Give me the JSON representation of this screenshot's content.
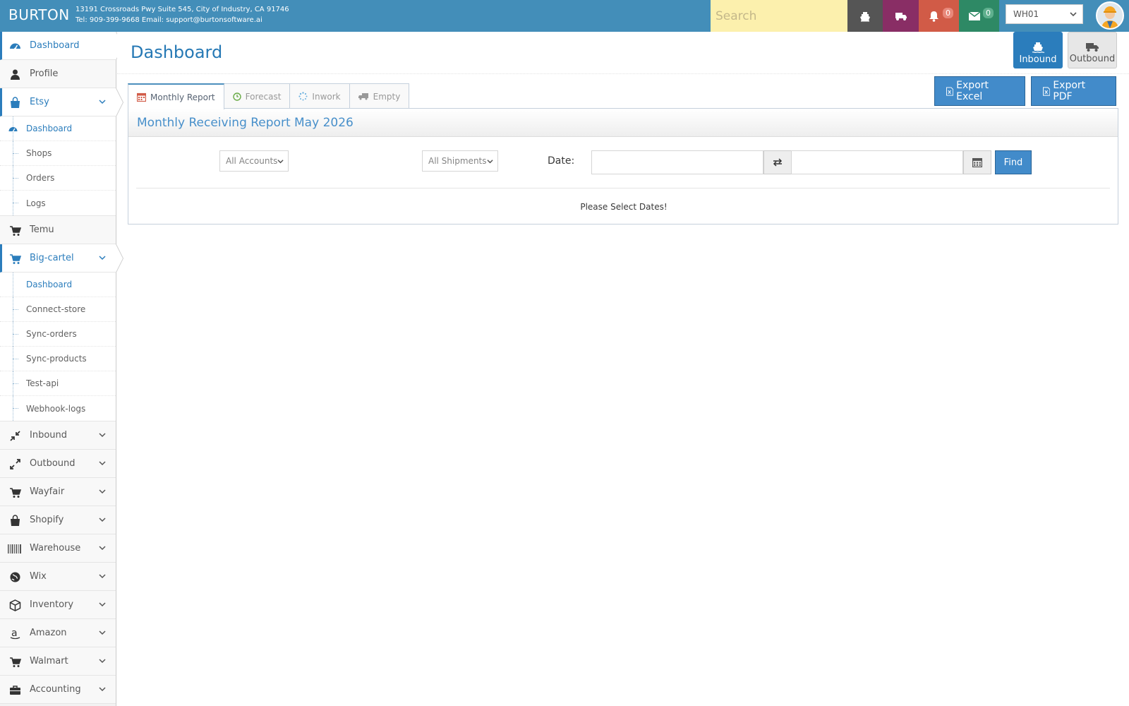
{
  "header": {
    "brand": "BURTON",
    "address_line1": "13191 Crossroads Pwy Suite 545, City of Industry, CA 91746",
    "address_line2": "Tel: 909-399-9668 Email: support@burtonsoftware.ai",
    "search_placeholder": "Search",
    "notifications_count": "0",
    "messages_count": "0",
    "warehouse_selected": "WH01",
    "colors": {
      "bar": "#438eb9",
      "search_bg": "#fcf0ad",
      "ship": "#555555",
      "truck": "#892e65",
      "bell": "#d15b47",
      "mail": "#2e8965"
    }
  },
  "sidebar": {
    "items": [
      {
        "label": "Dashboard",
        "icon": "tachometer-icon"
      },
      {
        "label": "Profile",
        "icon": "user-icon"
      },
      {
        "label": "Etsy",
        "icon": "shopping-bag-icon",
        "sub": [
          {
            "label": "Dashboard"
          },
          {
            "label": "Shops"
          },
          {
            "label": "Orders"
          },
          {
            "label": "Logs"
          }
        ]
      },
      {
        "label": "Temu",
        "icon": "cart-icon"
      },
      {
        "label": "Big-cartel",
        "icon": "cart-icon",
        "sub": [
          {
            "label": "Dashboard"
          },
          {
            "label": "Connect-store"
          },
          {
            "label": "Sync-orders"
          },
          {
            "label": "Sync-products"
          },
          {
            "label": "Test-api"
          },
          {
            "label": "Webhook-logs"
          }
        ]
      },
      {
        "label": "Inbound",
        "icon": "compress-icon"
      },
      {
        "label": "Outbound",
        "icon": "expand-icon"
      },
      {
        "label": "Wayfair",
        "icon": "cart-icon"
      },
      {
        "label": "Shopify",
        "icon": "shopping-bag-icon"
      },
      {
        "label": "Warehouse",
        "icon": "barcode-icon"
      },
      {
        "label": "Wix",
        "icon": "globe-icon"
      },
      {
        "label": "Inventory",
        "icon": "cube-icon"
      },
      {
        "label": "Amazon",
        "icon": "amazon-icon"
      },
      {
        "label": "Walmart",
        "icon": "cart-icon"
      },
      {
        "label": "Accounting",
        "icon": "briefcase-icon"
      }
    ]
  },
  "page": {
    "title": "Dashboard",
    "inbound_label": "Inbound",
    "outbound_label": "Outbound",
    "tabs": [
      {
        "label": "Monthly Report",
        "icon": "calendar-icon",
        "active": true
      },
      {
        "label": "Forecast",
        "icon": "clock-icon"
      },
      {
        "label": "Inwork",
        "icon": "spinner-icon"
      },
      {
        "label": "Empty",
        "icon": "truck-icon"
      }
    ],
    "export_excel": "Export Excel",
    "export_pdf": "Export PDF",
    "panel_title": "Monthly Receiving Report May 2026",
    "accounts_select": "All Accounts",
    "shipments_select": "All Shipments",
    "date_label": "Date:",
    "date_from": "",
    "date_to": "",
    "find_label": "Find",
    "message": "Please Select Dates!"
  }
}
